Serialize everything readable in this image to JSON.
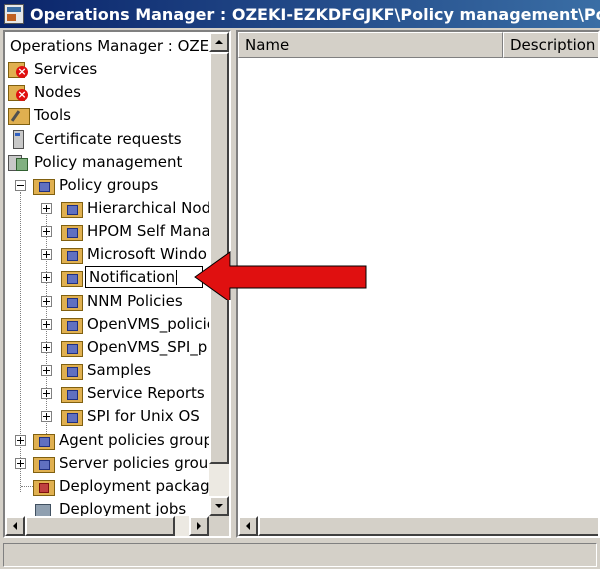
{
  "window": {
    "title": "Operations Manager : OZEKI-EZKDFGJKF\\Policy management\\Policy g"
  },
  "tree": {
    "root_label": "Operations Manager : OZEK",
    "items": [
      {
        "label": "Services",
        "icon": "services-icon"
      },
      {
        "label": "Nodes",
        "icon": "nodes-icon"
      },
      {
        "label": "Tools",
        "icon": "tools-icon"
      },
      {
        "label": "Certificate requests",
        "icon": "certificate-icon"
      },
      {
        "label": "Policy management",
        "icon": "policy-icon"
      },
      {
        "label": "Policy groups",
        "icon": "folder-icon"
      },
      {
        "label": "Hierarchical Nod",
        "icon": "folder-icon"
      },
      {
        "label": "HPOM Self Mana",
        "icon": "folder-icon"
      },
      {
        "label": "Microsoft Windo",
        "icon": "folder-icon"
      },
      {
        "label": "Notification",
        "icon": "folder-icon",
        "editing": true
      },
      {
        "label": "NNM Policies",
        "icon": "folder-icon"
      },
      {
        "label": "OpenVMS_policie",
        "icon": "folder-icon"
      },
      {
        "label": "OpenVMS_SPI_p",
        "icon": "folder-icon"
      },
      {
        "label": "Samples",
        "icon": "folder-icon"
      },
      {
        "label": "Service Reports",
        "icon": "folder-icon"
      },
      {
        "label": "SPI for Unix OS",
        "icon": "folder-icon"
      },
      {
        "label": "Agent policies group",
        "icon": "folder-icon"
      },
      {
        "label": "Server policies group",
        "icon": "folder-icon"
      },
      {
        "label": "Deployment package",
        "icon": "package-icon"
      },
      {
        "label": "Deployment jobs",
        "icon": "jobs-icon"
      }
    ]
  },
  "list": {
    "columns": [
      "Name",
      "Description"
    ]
  },
  "annotation": {
    "arrow_color": "#e01010"
  }
}
